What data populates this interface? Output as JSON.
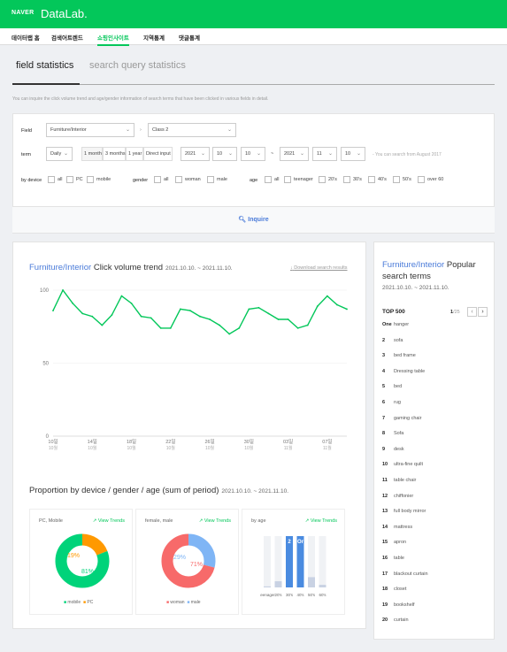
{
  "header": {
    "logo": "NAVER",
    "app_name": "DataLab."
  },
  "nav": [
    "데이터랩 홈",
    "검색어트렌드",
    "쇼핑인사이트",
    "지역통계",
    "댓글통계"
  ],
  "tabs": {
    "active": "field statistics",
    "other": "search query statistics"
  },
  "description": "You can inquire the click volume trend and age/gender information of search terms that have been clicked in various fields in detail.",
  "filters": {
    "field_label": "Field",
    "field_value": "Furniture/Interior",
    "class2": "Class 2",
    "term_label": "term",
    "period_unit": "Daily",
    "period_buttons": [
      "1 month",
      "3 months",
      "1 year",
      "Direct input"
    ],
    "start": {
      "year": "2021",
      "month": "10",
      "day": "10"
    },
    "sep": "~",
    "end": {
      "year": "2021",
      "month": "11",
      "day": "10"
    },
    "note": "- You can search from August 2017",
    "device_label": "by device",
    "device_options": [
      "all",
      "PC",
      "mobile"
    ],
    "gender_label": "gender",
    "gender_options": [
      "all",
      "woman",
      "male"
    ],
    "age_label": "age",
    "age_options": [
      "all",
      "teenager",
      "20's",
      "30's",
      "40's",
      "50's",
      "over 60"
    ]
  },
  "inquire_label": "Inquire",
  "trend": {
    "category": "Furniture/Interior",
    "title": " Click volume trend",
    "date_range": "2021.10.10. ~ 2021.11.10.",
    "download": "Download search results",
    "y_ticks": [
      "100",
      "50",
      "0"
    ],
    "x_ticks": [
      {
        "d": "10일",
        "m": "10월"
      },
      {
        "d": "14일",
        "m": "10월"
      },
      {
        "d": "18일",
        "m": "10월"
      },
      {
        "d": "22일",
        "m": "10월"
      },
      {
        "d": "26일",
        "m": "10월"
      },
      {
        "d": "30일",
        "m": "10월"
      },
      {
        "d": "03일",
        "m": "11월"
      },
      {
        "d": "07일",
        "m": "11월"
      }
    ]
  },
  "chart_data": {
    "type": "line",
    "x": [
      "10.10",
      "10.11",
      "10.12",
      "10.13",
      "10.14",
      "10.15",
      "10.16",
      "10.17",
      "10.18",
      "10.19",
      "10.20",
      "10.21",
      "10.22",
      "10.23",
      "10.24",
      "10.25",
      "10.26",
      "10.27",
      "10.28",
      "10.29",
      "10.30",
      "10.31",
      "11.01",
      "11.02",
      "11.03",
      "11.04",
      "11.05",
      "11.06",
      "11.07",
      "11.08",
      "11.09"
    ],
    "values": [
      86,
      100,
      91,
      84,
      82,
      76,
      83,
      96,
      91,
      82,
      81,
      74,
      74,
      87,
      86,
      82,
      80,
      76,
      70,
      74,
      87,
      88,
      84,
      80,
      80,
      74,
      76,
      89,
      96,
      90,
      87
    ],
    "ylim": [
      0,
      100
    ],
    "color": "#03c75a"
  },
  "proportion": {
    "title": "Proportion by device / gender / age (sum of period)",
    "date_range": "2021.10.10. ~ 2021.11.10.",
    "view_trends": "View Trends",
    "device": {
      "title": "PC, Mobile",
      "pc": 19,
      "mobile": 81,
      "pc_label": "19%",
      "mobile_label": "81%",
      "legend": [
        "mobile",
        "PC"
      ],
      "colors": {
        "mobile": "#00d37a",
        "pc": "#ff9900"
      }
    },
    "gender": {
      "title": "female, male",
      "female": 71,
      "male": 29,
      "female_label": "71%",
      "male_label": "29%",
      "legend": [
        "woman",
        "male"
      ],
      "colors": {
        "female": "#f76a6a",
        "male": "#7fb5f5"
      }
    },
    "age": {
      "title": "by age",
      "labels": [
        "teenager",
        "20's",
        "30's",
        "40's",
        "50's",
        "60's"
      ],
      "values": [
        2,
        12,
        100,
        100,
        20,
        5
      ],
      "value_labels": {
        "30's": "2",
        "40's": "Or"
      },
      "highlight_color": "#4a8be0",
      "other_color": "#c9d2e3"
    }
  },
  "popular": {
    "category": "Furniture/Interior",
    "title": " Popular search terms",
    "date_range": "2021.10.10. ~ 2021.11.10.",
    "top_label": "TOP 500",
    "page": "1",
    "pages": "/25",
    "items": [
      {
        "rank": "One",
        "term": "hanger"
      },
      {
        "rank": "2",
        "term": "sofa"
      },
      {
        "rank": "3",
        "term": "bed frame"
      },
      {
        "rank": "4",
        "term": "Dressing table"
      },
      {
        "rank": "5",
        "term": "bed"
      },
      {
        "rank": "6",
        "term": "rug"
      },
      {
        "rank": "7",
        "term": "gaming chair"
      },
      {
        "rank": "8",
        "term": "Sofa"
      },
      {
        "rank": "9",
        "term": "desk"
      },
      {
        "rank": "10",
        "term": "ultra-fine quilt"
      },
      {
        "rank": "11",
        "term": "table chair"
      },
      {
        "rank": "12",
        "term": "chiffonier"
      },
      {
        "rank": "13",
        "term": "full body mirror"
      },
      {
        "rank": "14",
        "term": "mattress"
      },
      {
        "rank": "15",
        "term": "apron"
      },
      {
        "rank": "16",
        "term": "table"
      },
      {
        "rank": "17",
        "term": "blackout curtain"
      },
      {
        "rank": "18",
        "term": "closet"
      },
      {
        "rank": "19",
        "term": "bookshelf"
      },
      {
        "rank": "20",
        "term": "curtain"
      }
    ]
  }
}
